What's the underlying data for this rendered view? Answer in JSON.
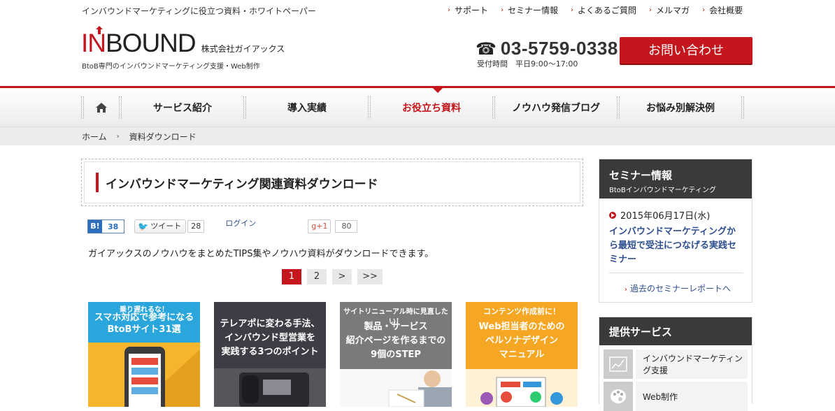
{
  "header": {
    "tagline": "インバウンドマーケティングに役立つ資料・ホワイトペーパー",
    "top_links": [
      "サポート",
      "セミナー情報",
      "よくあるご質問",
      "メルマガ",
      "会社概要"
    ],
    "logo_in": "IN",
    "logo_bound": "BOUND",
    "company": "株式会社ガイアックス",
    "logo_sub": "BtoB専門のインバウンドマーケティング支援・Web制作",
    "phone_icon": "☎",
    "phone": "03-5759-0338",
    "hours": "受付時間　平日9:00〜17:00",
    "contact_button": "お問い合わせ",
    "accent_color": "#c4161c"
  },
  "nav": {
    "items": [
      "サービス紹介",
      "導入実績",
      "お役立ち資料",
      "ノウハウ発信ブログ",
      "お悩み別解決例"
    ],
    "selected": "お役立ち資料"
  },
  "breadcrumb": {
    "home": "ホーム",
    "current": "資料ダウンロード"
  },
  "main": {
    "title": "インバウンドマーケティング関連資料ダウンロード",
    "social": {
      "hatena_label": "B!",
      "hatena_count": "38",
      "tweet_label": "ツイート",
      "tweet_count": "28",
      "login": "ログイン",
      "gplus_label": "g+1",
      "gplus_count": "80"
    },
    "description": "ガイアックスのノウハウをまとめたTIPS集やノウハウ資料がダウンロードできます。",
    "pager": [
      "1",
      "2",
      ">",
      ">>"
    ],
    "cards": [
      {
        "tag": "乗り遅れるな！",
        "title_lines": [
          "スマホ対応で参考になる",
          "BtoBサイト31選"
        ]
      },
      {
        "tag": "",
        "title_lines": [
          "テレアポに変わる手法、",
          "インバウンド型営業を",
          "実践する3つのポイント"
        ]
      },
      {
        "tag": "サイトリニューアル時に見直したい！",
        "title_lines": [
          "製品・サービス",
          "紹介ページを作るまでの",
          "9個のSTEP"
        ]
      },
      {
        "tag": "コンテンツ作成前に！",
        "title_lines": [
          "Web担当者のための",
          "ペルソナデザイン",
          "マニュアル"
        ]
      }
    ]
  },
  "sidebar": {
    "seminar": {
      "heading": "セミナー情報",
      "sub": "BtoBインバウンドマーケティング",
      "date": "2015年06月17日(水)",
      "title": "インバウンドマーケティングから最短で受注につなげる実践セミナー",
      "past_link": "過去のセミナーレポートへ"
    },
    "services": {
      "heading": "提供サービス",
      "items": [
        {
          "label": "インバウンドマーケティング支援",
          "icon": "chart-icon"
        },
        {
          "label": "Web制作",
          "icon": "palette-icon"
        }
      ]
    }
  }
}
